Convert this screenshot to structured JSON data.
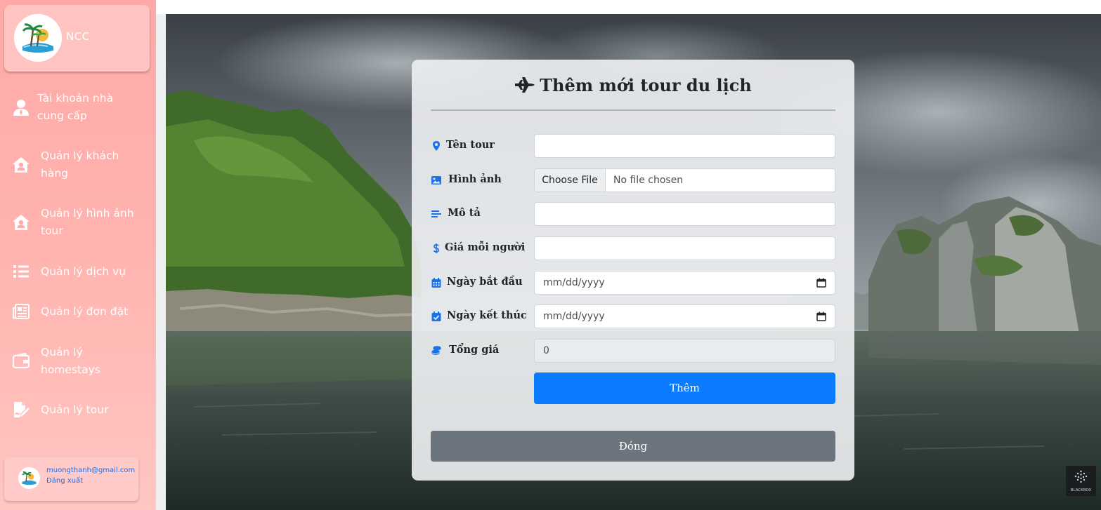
{
  "sidebar": {
    "brand": {
      "name": "NCC"
    },
    "items": [
      {
        "label": "Tài khoản nhà cung cấp",
        "icon": "user-tie-icon"
      },
      {
        "label": "Quản lý khách hàng",
        "icon": "house-user-icon"
      },
      {
        "label": "Quản lý hình ảnh tour",
        "icon": "house-user-icon"
      },
      {
        "label": "Quản lý dịch vụ",
        "icon": "list-icon"
      },
      {
        "label": "Quản lý đơn đặt",
        "icon": "newspaper-icon"
      },
      {
        "label": "Quản lý homestays",
        "icon": "wallet-icon"
      },
      {
        "label": "Quản lý tour",
        "icon": "file-signature-icon"
      }
    ],
    "user": {
      "email": "muongthanh@gmail.com",
      "logout_label": "Đăng xuất"
    }
  },
  "form": {
    "title": "Thêm mới tour du lịch",
    "fields": {
      "name": {
        "label": "Tên tour",
        "value": ""
      },
      "image": {
        "label": "Hình ảnh",
        "button": "Choose File",
        "status": "No file chosen"
      },
      "description": {
        "label": "Mô tả",
        "value": ""
      },
      "price": {
        "label": "Giá mỗi người",
        "value": ""
      },
      "start_date": {
        "label": "Ngày bắt đầu",
        "placeholder": "mm/dd/yyyy"
      },
      "end_date": {
        "label": "Ngày kết thúc",
        "placeholder": "mm/dd/yyyy"
      },
      "total": {
        "label": "Tổng giá",
        "value": "0"
      }
    },
    "submit_label": "Thêm",
    "close_label": "Đóng"
  },
  "watermark": {
    "text": "BLACKBOX"
  },
  "colors": {
    "sidebar": "#ffaaa8",
    "primary": "#0d7bfd",
    "secondary": "#6c757d",
    "icon_blue": "#1a73e8"
  }
}
